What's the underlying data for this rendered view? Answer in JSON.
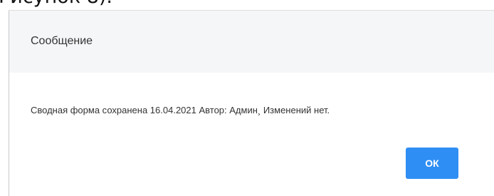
{
  "background": {
    "partial_text": "Рисунок 8)."
  },
  "dialog": {
    "title": "Сообщение",
    "message": "Сводная форма сохранена 16.04.2021 Автор: Админ¸ Изменений нет.",
    "ok_label": "ОК",
    "header_color": "#f5f6f8",
    "button_color": "#2f8ef4"
  }
}
